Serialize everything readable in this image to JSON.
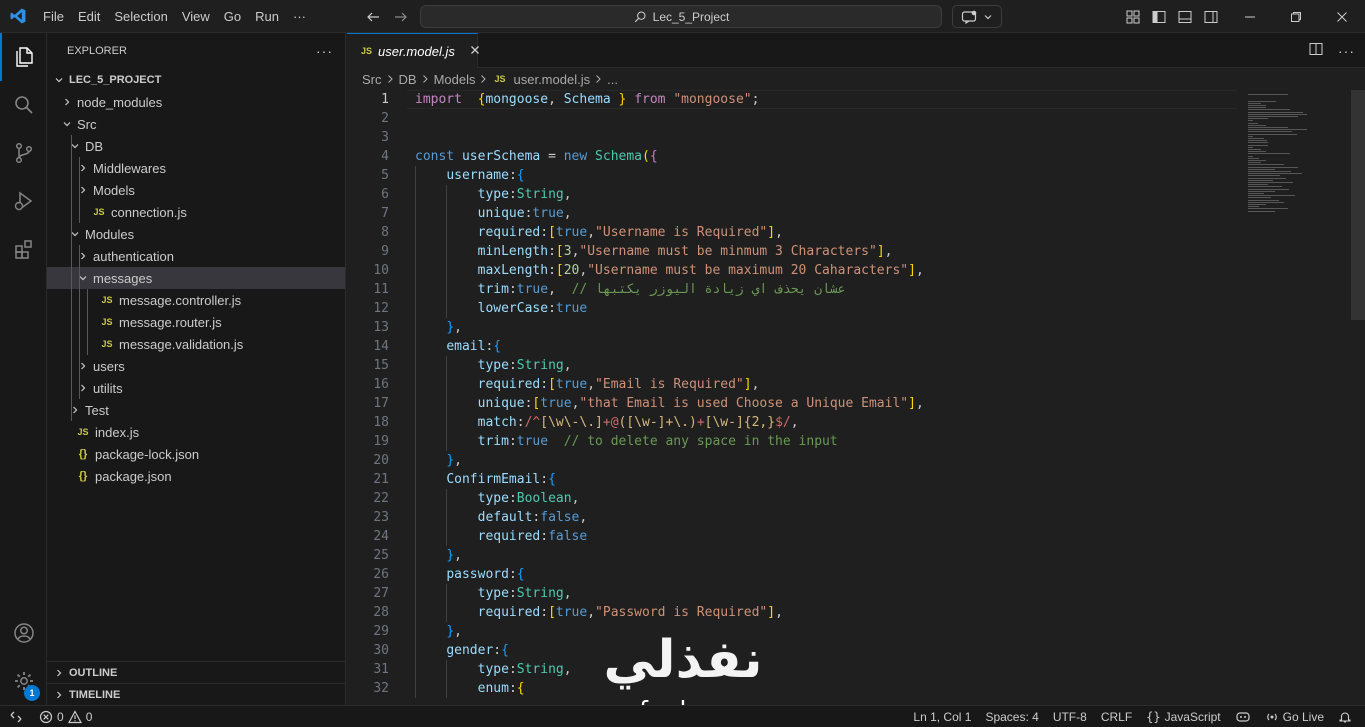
{
  "titlebar": {
    "menu": [
      "File",
      "Edit",
      "Selection",
      "View",
      "Go",
      "Run",
      "···"
    ],
    "search_text": "Lec_5_Project"
  },
  "sidebar": {
    "title": "EXPLORER",
    "more": "···",
    "tree": [
      {
        "label": "LEC_5_PROJECT",
        "depth": 0,
        "type": "root"
      },
      {
        "label": "node_modules",
        "depth": 1,
        "type": "folder-closed"
      },
      {
        "label": "Src",
        "depth": 1,
        "type": "folder-open"
      },
      {
        "label": "DB",
        "depth": 2,
        "type": "folder-open"
      },
      {
        "label": "Middlewares",
        "depth": 3,
        "type": "folder-closed"
      },
      {
        "label": "Models",
        "depth": 3,
        "type": "folder-closed"
      },
      {
        "label": "connection.js",
        "depth": 3,
        "type": "js"
      },
      {
        "label": "Modules",
        "depth": 2,
        "type": "folder-open"
      },
      {
        "label": "authentication",
        "depth": 3,
        "type": "folder-closed"
      },
      {
        "label": "messages",
        "depth": 3,
        "type": "folder-open",
        "selected": true
      },
      {
        "label": "message.controller.js",
        "depth": 4,
        "type": "js"
      },
      {
        "label": "message.router.js",
        "depth": 4,
        "type": "js"
      },
      {
        "label": "message.validation.js",
        "depth": 4,
        "type": "js"
      },
      {
        "label": "users",
        "depth": 3,
        "type": "folder-closed"
      },
      {
        "label": "utilits",
        "depth": 3,
        "type": "folder-closed"
      },
      {
        "label": "Test",
        "depth": 2,
        "type": "folder-closed"
      },
      {
        "label": "index.js",
        "depth": 1,
        "type": "js"
      },
      {
        "label": "package-lock.json",
        "depth": 1,
        "type": "json"
      },
      {
        "label": "package.json",
        "depth": 1,
        "type": "json"
      }
    ],
    "outline": "OUTLINE",
    "timeline": "TIMELINE"
  },
  "activity": {
    "accounts_badge": "1"
  },
  "editor": {
    "tab_icon": "JS",
    "tab_label": "user.model.js",
    "breadcrumbs": [
      "Src",
      "DB",
      "Models",
      "user.model.js",
      "..."
    ],
    "current_line": 1
  },
  "code": [
    [
      [
        "k",
        "import"
      ],
      [
        "",
        "  "
      ],
      [
        "b1",
        "{"
      ],
      [
        "v",
        "mongoose"
      ],
      [
        "",
        ", "
      ],
      [
        "v",
        "Schema"
      ],
      [
        "",
        " "
      ],
      [
        "b1",
        "}"
      ],
      [
        "",
        " "
      ],
      [
        "k",
        "from"
      ],
      [
        "",
        " "
      ],
      [
        "s",
        "\"mongoose\""
      ],
      [
        "",
        ";"
      ]
    ],
    [],
    [],
    [
      [
        "kb",
        "const"
      ],
      [
        "",
        " "
      ],
      [
        "v",
        "userSchema"
      ],
      [
        "",
        " = "
      ],
      [
        "kb",
        "new"
      ],
      [
        "",
        " "
      ],
      [
        "t",
        "Schema"
      ],
      [
        "b1",
        "("
      ],
      [
        "b2",
        "{"
      ]
    ],
    [
      [
        "",
        "    "
      ],
      [
        "v",
        "username"
      ],
      [
        "",
        ":"
      ],
      [
        "b3",
        "{"
      ]
    ],
    [
      [
        "",
        "        "
      ],
      [
        "v",
        "type"
      ],
      [
        "",
        ":"
      ],
      [
        "t",
        "String"
      ],
      [
        "",
        ","
      ]
    ],
    [
      [
        "",
        "        "
      ],
      [
        "v",
        "unique"
      ],
      [
        "",
        ":"
      ],
      [
        "kb",
        "true"
      ],
      [
        "",
        ","
      ]
    ],
    [
      [
        "",
        "        "
      ],
      [
        "v",
        "required"
      ],
      [
        "",
        ":"
      ],
      [
        "b1",
        "["
      ],
      [
        "kb",
        "true"
      ],
      [
        "",
        ","
      ],
      [
        "s",
        "\"Username is Required\""
      ],
      [
        "b1",
        "]"
      ],
      [
        "",
        ","
      ]
    ],
    [
      [
        "",
        "        "
      ],
      [
        "v",
        "minLength"
      ],
      [
        "",
        ":"
      ],
      [
        "b1",
        "["
      ],
      [
        "n",
        "3"
      ],
      [
        "",
        ","
      ],
      [
        "s",
        "\"Username must be minmum 3 Characters\""
      ],
      [
        "b1",
        "]"
      ],
      [
        "",
        ","
      ]
    ],
    [
      [
        "",
        "        "
      ],
      [
        "v",
        "maxLength"
      ],
      [
        "",
        ":"
      ],
      [
        "b1",
        "["
      ],
      [
        "n",
        "20"
      ],
      [
        "",
        ","
      ],
      [
        "s",
        "\"Username must be maximum 20 Caharacters\""
      ],
      [
        "b1",
        "]"
      ],
      [
        "",
        ","
      ]
    ],
    [
      [
        "",
        "        "
      ],
      [
        "v",
        "trim"
      ],
      [
        "",
        ":"
      ],
      [
        "kb",
        "true"
      ],
      [
        "",
        ",  "
      ],
      [
        "c",
        "// عشان يحذف اي زيادة اليوزر يكتبها"
      ]
    ],
    [
      [
        "",
        "        "
      ],
      [
        "v",
        "lowerCase"
      ],
      [
        "",
        ":"
      ],
      [
        "kb",
        "true"
      ]
    ],
    [
      [
        "",
        "    "
      ],
      [
        "b3",
        "}"
      ],
      [
        "",
        ","
      ]
    ],
    [
      [
        "",
        "    "
      ],
      [
        "v",
        "email"
      ],
      [
        "",
        ":"
      ],
      [
        "b3",
        "{"
      ]
    ],
    [
      [
        "",
        "        "
      ],
      [
        "v",
        "type"
      ],
      [
        "",
        ":"
      ],
      [
        "t",
        "String"
      ],
      [
        "",
        ","
      ]
    ],
    [
      [
        "",
        "        "
      ],
      [
        "v",
        "required"
      ],
      [
        "",
        ":"
      ],
      [
        "b1",
        "["
      ],
      [
        "kb",
        "true"
      ],
      [
        "",
        ","
      ],
      [
        "s",
        "\"Email is Required\""
      ],
      [
        "b1",
        "]"
      ],
      [
        "",
        ","
      ]
    ],
    [
      [
        "",
        "        "
      ],
      [
        "v",
        "unique"
      ],
      [
        "",
        ":"
      ],
      [
        "b1",
        "["
      ],
      [
        "kb",
        "true"
      ],
      [
        "",
        ","
      ],
      [
        "s",
        "\"that Email is used Choose a Unique Email\""
      ],
      [
        "b1",
        "]"
      ],
      [
        "",
        ","
      ]
    ],
    [
      [
        "",
        "        "
      ],
      [
        "v",
        "match"
      ],
      [
        "",
        ":"
      ],
      [
        "re",
        "/^"
      ],
      [
        "rx",
        "[\\w\\-\\.]"
      ],
      [
        "re",
        "+@"
      ],
      [
        "rx",
        "([\\w-]+\\.)"
      ],
      [
        "re",
        "+"
      ],
      [
        "rx",
        "[\\w-]{2,}"
      ],
      [
        "re",
        "$/"
      ],
      [
        "",
        ","
      ]
    ],
    [
      [
        "",
        "        "
      ],
      [
        "v",
        "trim"
      ],
      [
        "",
        ":"
      ],
      [
        "kb",
        "true"
      ],
      [
        "",
        "  "
      ],
      [
        "c",
        "// to delete any space in the input"
      ]
    ],
    [
      [
        "",
        "    "
      ],
      [
        "b3",
        "}"
      ],
      [
        "",
        ","
      ]
    ],
    [
      [
        "",
        "    "
      ],
      [
        "v",
        "ConfirmEmail"
      ],
      [
        "",
        ":"
      ],
      [
        "b3",
        "{"
      ]
    ],
    [
      [
        "",
        "        "
      ],
      [
        "v",
        "type"
      ],
      [
        "",
        ":"
      ],
      [
        "t",
        "Boolean"
      ],
      [
        "",
        ","
      ]
    ],
    [
      [
        "",
        "        "
      ],
      [
        "v",
        "default"
      ],
      [
        "",
        ":"
      ],
      [
        "kb",
        "false"
      ],
      [
        "",
        ","
      ]
    ],
    [
      [
        "",
        "        "
      ],
      [
        "v",
        "required"
      ],
      [
        "",
        ":"
      ],
      [
        "kb",
        "false"
      ]
    ],
    [
      [
        "",
        "    "
      ],
      [
        "b3",
        "}"
      ],
      [
        "",
        ","
      ]
    ],
    [
      [
        "",
        "    "
      ],
      [
        "v",
        "password"
      ],
      [
        "",
        ":"
      ],
      [
        "b3",
        "{"
      ]
    ],
    [
      [
        "",
        "        "
      ],
      [
        "v",
        "type"
      ],
      [
        "",
        ":"
      ],
      [
        "t",
        "String"
      ],
      [
        "",
        ","
      ]
    ],
    [
      [
        "",
        "        "
      ],
      [
        "v",
        "required"
      ],
      [
        "",
        ":"
      ],
      [
        "b1",
        "["
      ],
      [
        "kb",
        "true"
      ],
      [
        "",
        ","
      ],
      [
        "s",
        "\"Password is Required\""
      ],
      [
        "b1",
        "]"
      ],
      [
        "",
        ","
      ]
    ],
    [
      [
        "",
        "    "
      ],
      [
        "b3",
        "}"
      ],
      [
        "",
        ","
      ]
    ],
    [
      [
        "",
        "    "
      ],
      [
        "v",
        "gender"
      ],
      [
        "",
        ":"
      ],
      [
        "b3",
        "{"
      ]
    ],
    [
      [
        "",
        "        "
      ],
      [
        "v",
        "type"
      ],
      [
        "",
        ":"
      ],
      [
        "t",
        "String"
      ],
      [
        "",
        ","
      ]
    ],
    [
      [
        "",
        "        "
      ],
      [
        "v",
        "enum"
      ],
      [
        "",
        ":"
      ],
      [
        "b1",
        "{"
      ]
    ]
  ],
  "watermark": {
    "arabic": "نفذلي",
    "latin": "nafezly.com"
  },
  "status": {
    "errors": "0",
    "warnings": "0",
    "position": "Ln 1, Col 1",
    "spaces": "Spaces: 4",
    "encoding": "UTF-8",
    "eol": "CRLF",
    "language": "JavaScript",
    "golive": "Go Live"
  },
  "colors": {
    "accent": "#0078d4",
    "js_icon": "#cbcb41"
  }
}
